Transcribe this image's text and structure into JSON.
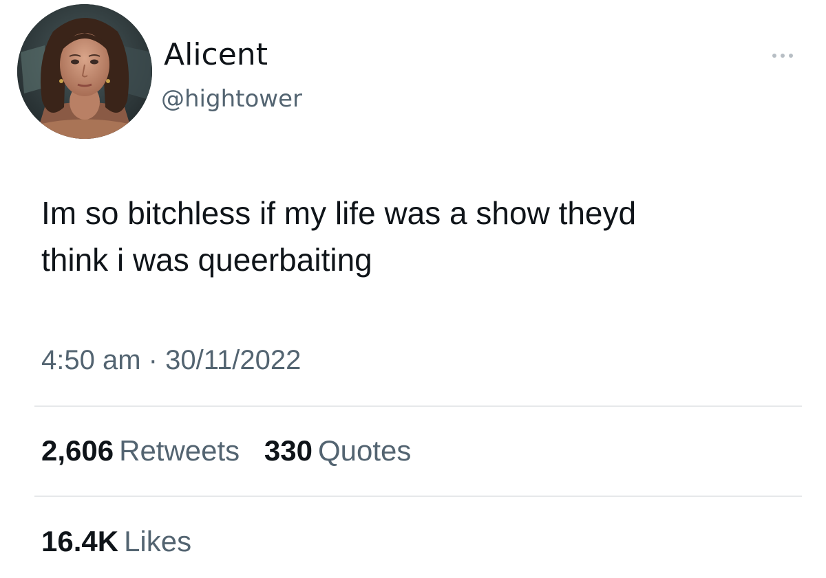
{
  "user": {
    "display_name": "Alicent",
    "handle": "@hightower",
    "avatar_icon": "profile-photo"
  },
  "more_menu_icon": "ellipsis-icon",
  "tweet": {
    "lines": [
      "Im so bitchless if my life was a show theyd",
      "think i was queerbaiting"
    ],
    "time": "4:50 am",
    "separator": "·",
    "date": "30/11/2022"
  },
  "stats": {
    "retweets": {
      "count": "2,606",
      "label": "Retweets"
    },
    "quotes": {
      "count": "330",
      "label": "Quotes"
    },
    "likes": {
      "count": "16.4K",
      "label": "Likes"
    }
  },
  "colors": {
    "primary_text": "#0f1419",
    "secondary_text": "#536471",
    "divider": "#e6e8ea",
    "background": "#ffffff"
  }
}
